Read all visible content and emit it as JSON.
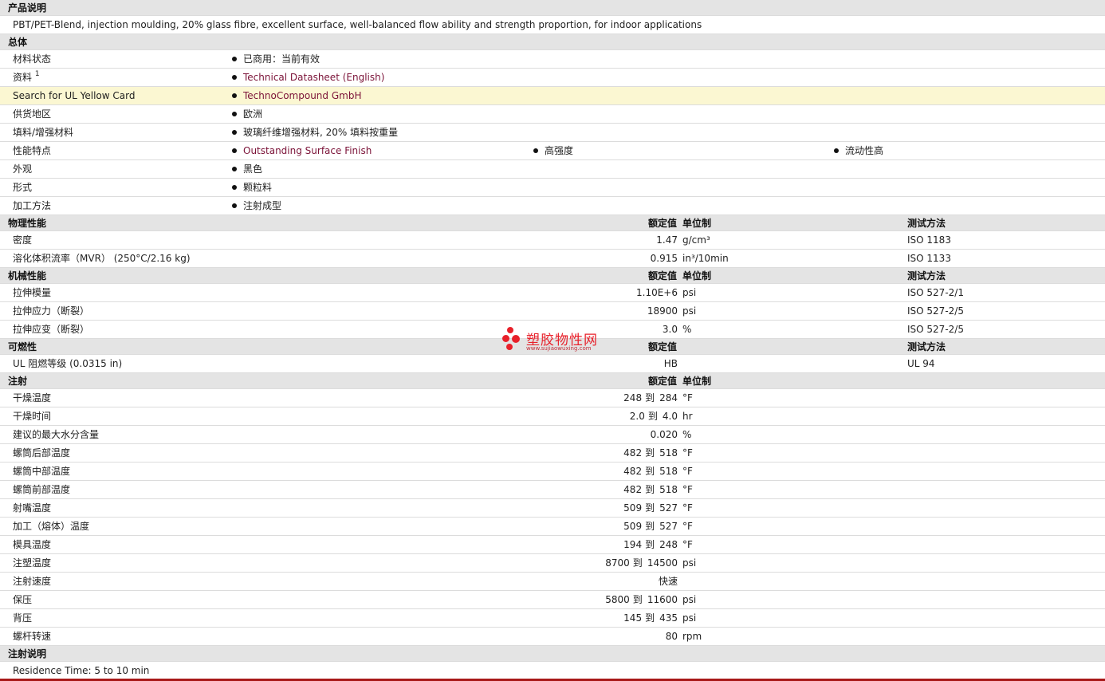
{
  "sections": {
    "desc": "产品说明",
    "general": "总体",
    "physical": "物理性能",
    "mechanical": "机械性能",
    "flammability": "可燃性",
    "injection": "注射",
    "injection_notes": "注射说明"
  },
  "headers": {
    "nominal": "额定值",
    "units": "单位制",
    "test_method": "测试方法"
  },
  "description": "PBT/PET-Blend, injection moulding, 20% glass fibre, excellent surface, well-balanced flow ability and strength proportion, for indoor applications",
  "general": {
    "status_label": "材料状态",
    "status_value": "已商用：当前有效",
    "docs_label": "资料",
    "docs_sup": "1",
    "docs_value": "Technical Datasheet (English)",
    "ul_label": "Search for UL Yellow Card",
    "ul_value": "TechnoCompound GmbH",
    "region_label": "供货地区",
    "region_value": "欧洲",
    "filler_label": "填料/增强材料",
    "filler_value": "玻璃纤维增强材料, 20% 填料按重量",
    "features_label": "性能特点",
    "features_1": "Outstanding Surface Finish",
    "features_2": "高强度",
    "features_3": "流动性高",
    "appearance_label": "外观",
    "appearance_value": "黑色",
    "form_label": "形式",
    "form_value": "颗粒料",
    "process_label": "加工方法",
    "process_value": "注射成型"
  },
  "physical": [
    {
      "label": "密度",
      "value": "1.47",
      "unit": "g/cm³",
      "test": "ISO 1183"
    },
    {
      "label": "溶化体积流率（MVR） (250°C/2.16 kg)",
      "value": "0.915",
      "unit": "in³/10min",
      "test": "ISO 1133"
    }
  ],
  "mechanical": [
    {
      "label": "拉伸模量",
      "value": "1.10E+6",
      "unit": "psi",
      "test": "ISO 527-2/1"
    },
    {
      "label": "拉伸应力（断裂）",
      "value": "18900",
      "unit": "psi",
      "test": "ISO 527-2/5"
    },
    {
      "label": "拉伸应变（断裂）",
      "value": "3.0",
      "unit": "%",
      "test": "ISO 527-2/5"
    }
  ],
  "flammability": [
    {
      "label": "UL 阻燃等级 (0.0315 in)",
      "value": "HB",
      "test": "UL 94"
    }
  ],
  "to_word": "到",
  "injection": [
    {
      "label": "干燥温度",
      "from": "248",
      "to": "284",
      "unit": "°F"
    },
    {
      "label": "干燥时间",
      "from": "2.0",
      "to": "4.0",
      "unit": "hr"
    },
    {
      "label": "建议的最大水分含量",
      "value": "0.020",
      "unit": "%"
    },
    {
      "label": "螺筒后部温度",
      "from": "482",
      "to": "518",
      "unit": "°F"
    },
    {
      "label": "螺筒中部温度",
      "from": "482",
      "to": "518",
      "unit": "°F"
    },
    {
      "label": "螺筒前部温度",
      "from": "482",
      "to": "518",
      "unit": "°F"
    },
    {
      "label": "射嘴温度",
      "from": "509",
      "to": "527",
      "unit": "°F"
    },
    {
      "label": "加工（熔体）温度",
      "from": "509",
      "to": "527",
      "unit": "°F"
    },
    {
      "label": "模具温度",
      "from": "194",
      "to": "248",
      "unit": "°F"
    },
    {
      "label": "注塑温度",
      "from": "8700",
      "to": "14500",
      "unit": "psi"
    },
    {
      "label": "注射速度",
      "value": "快速",
      "unit": ""
    },
    {
      "label": "保压",
      "from": "5800",
      "to": "11600",
      "unit": "psi"
    },
    {
      "label": "背压",
      "from": "145",
      "to": "435",
      "unit": "psi"
    },
    {
      "label": "螺杆转速",
      "value": "80",
      "unit": "rpm"
    }
  ],
  "injection_notes": "Residence Time: 5 to 10 min",
  "watermark": {
    "title": "塑胶物性网",
    "url": "www.sujiaowuxing.com",
    "color": "#e8202a"
  }
}
